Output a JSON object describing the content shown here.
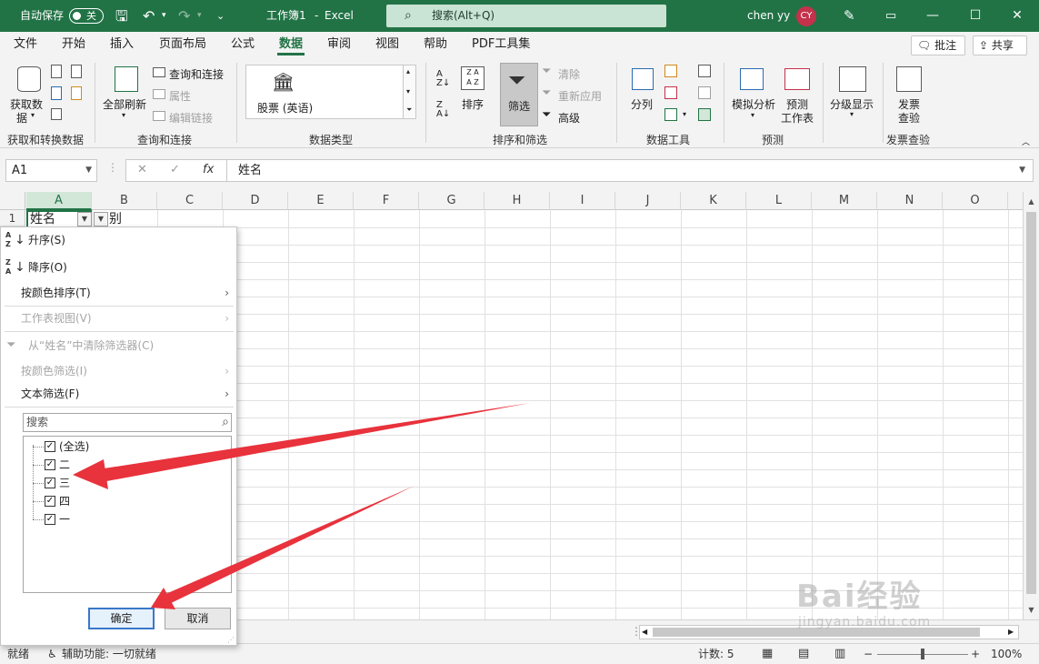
{
  "titlebar": {
    "autosave_label": "自动保存",
    "autosave_state": "关",
    "doc_title": "工作簿1",
    "sep": "-",
    "app_name": "Excel",
    "search_placeholder": "搜索(Alt+Q)",
    "user_name": "chen yy",
    "user_initials": "CY",
    "accent_color": "#217346"
  },
  "tabs": [
    "文件",
    "开始",
    "插入",
    "页面布局",
    "公式",
    "数据",
    "审阅",
    "视图",
    "帮助",
    "PDF工具集"
  ],
  "active_tab": "数据",
  "tab_buttons": {
    "comments": "批注",
    "share": "共享"
  },
  "ribbon": {
    "get_data_line1": "获取数",
    "get_data_line2": "据",
    "refresh_all": "全部刷新",
    "queries_connections": "查询和连接",
    "properties": "属性",
    "edit_links": "编辑链接",
    "stocks": "股票 (英语)",
    "sort": "排序",
    "filter": "筛选",
    "clear": "清除",
    "reapply": "重新应用",
    "advanced": "高级",
    "text_to_columns": "分列",
    "what_if": "模拟分析",
    "forecast_line1": "预测",
    "forecast_line2": "工作表",
    "outline": "分级显示",
    "invoice_line1": "发票",
    "invoice_line2": "查验",
    "groups": [
      "获取和转换数据",
      "查询和连接",
      "数据类型",
      "排序和筛选",
      "数据工具",
      "预测",
      "发票查验"
    ]
  },
  "formula_bar": {
    "name_box": "A1",
    "cancel": "✕",
    "enter": "✓",
    "fx": "fx",
    "content": "姓名"
  },
  "grid": {
    "columns": [
      "A",
      "B",
      "C",
      "D",
      "E",
      "F",
      "G",
      "H",
      "I",
      "J",
      "K",
      "L",
      "M",
      "N",
      "O"
    ],
    "row1_label": "1",
    "a1": "姓名",
    "b1": "别"
  },
  "filter_menu": {
    "sort_asc": "升序(S)",
    "sort_desc": "降序(O)",
    "sort_by_color": "按颜色排序(T)",
    "sheet_view": "工作表视图(V)",
    "clear_filter": "从“姓名”中清除筛选器(C)",
    "filter_by_color": "按颜色筛选(I)",
    "text_filter": "文本筛选(F)",
    "search_placeholder": "搜索",
    "items": [
      {
        "label": "(全选)",
        "checked": true
      },
      {
        "label": "二",
        "checked": true
      },
      {
        "label": "三",
        "checked": true
      },
      {
        "label": "四",
        "checked": true
      },
      {
        "label": "一",
        "checked": true
      }
    ],
    "ok": "确定",
    "cancel": "取消"
  },
  "status_bar": {
    "ready": "就绪",
    "accessibility": "辅助功能: 一切就绪",
    "count": "计数: 5",
    "zoom": "100%"
  },
  "watermark": {
    "brand": "Bai经验",
    "url": "jingyan.baidu.com"
  },
  "annotation_color": "#e8323c"
}
